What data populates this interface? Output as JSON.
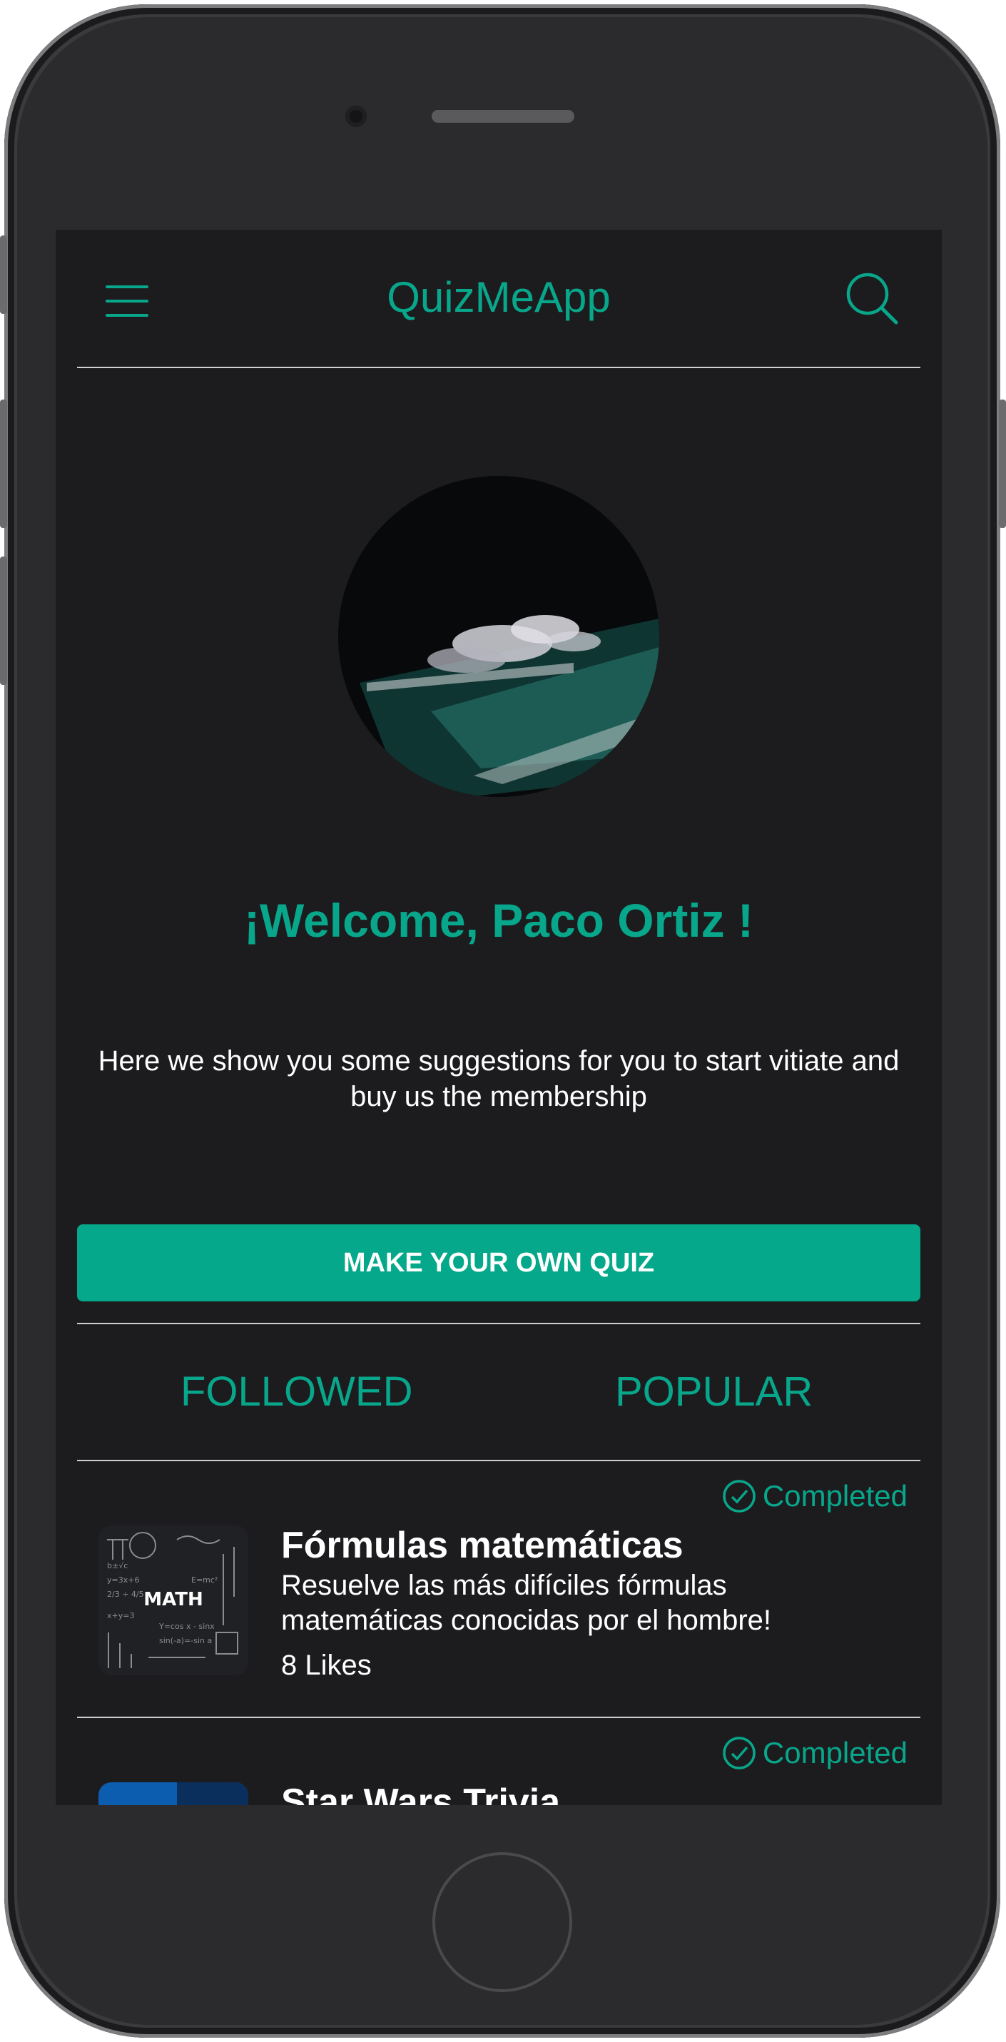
{
  "header": {
    "app_title": "QuizMeApp"
  },
  "profile": {
    "welcome": "¡Welcome, Paco Ortiz !",
    "intro": "Here we show you some suggestions for you to start  vitiate and buy us the membership"
  },
  "cta": {
    "label": "MAKE YOUR OWN QUIZ"
  },
  "tabs": [
    {
      "label": "FOLLOWED"
    },
    {
      "label": "POPULAR"
    }
  ],
  "quizzes": [
    {
      "status": "Completed",
      "title": "Fórmulas matemáticas",
      "description": "Resuelve las más difíciles fórmulas matemáticas conocidas por el hombre!",
      "likes": "8 Likes",
      "thumb_text": "MATH"
    },
    {
      "status": "Completed",
      "title": "Star Wars Trivia"
    }
  ],
  "colors": {
    "accent": "#08a68a",
    "cta": "#05a88a",
    "background": "#1c1c1f",
    "text": "#ffffff"
  }
}
